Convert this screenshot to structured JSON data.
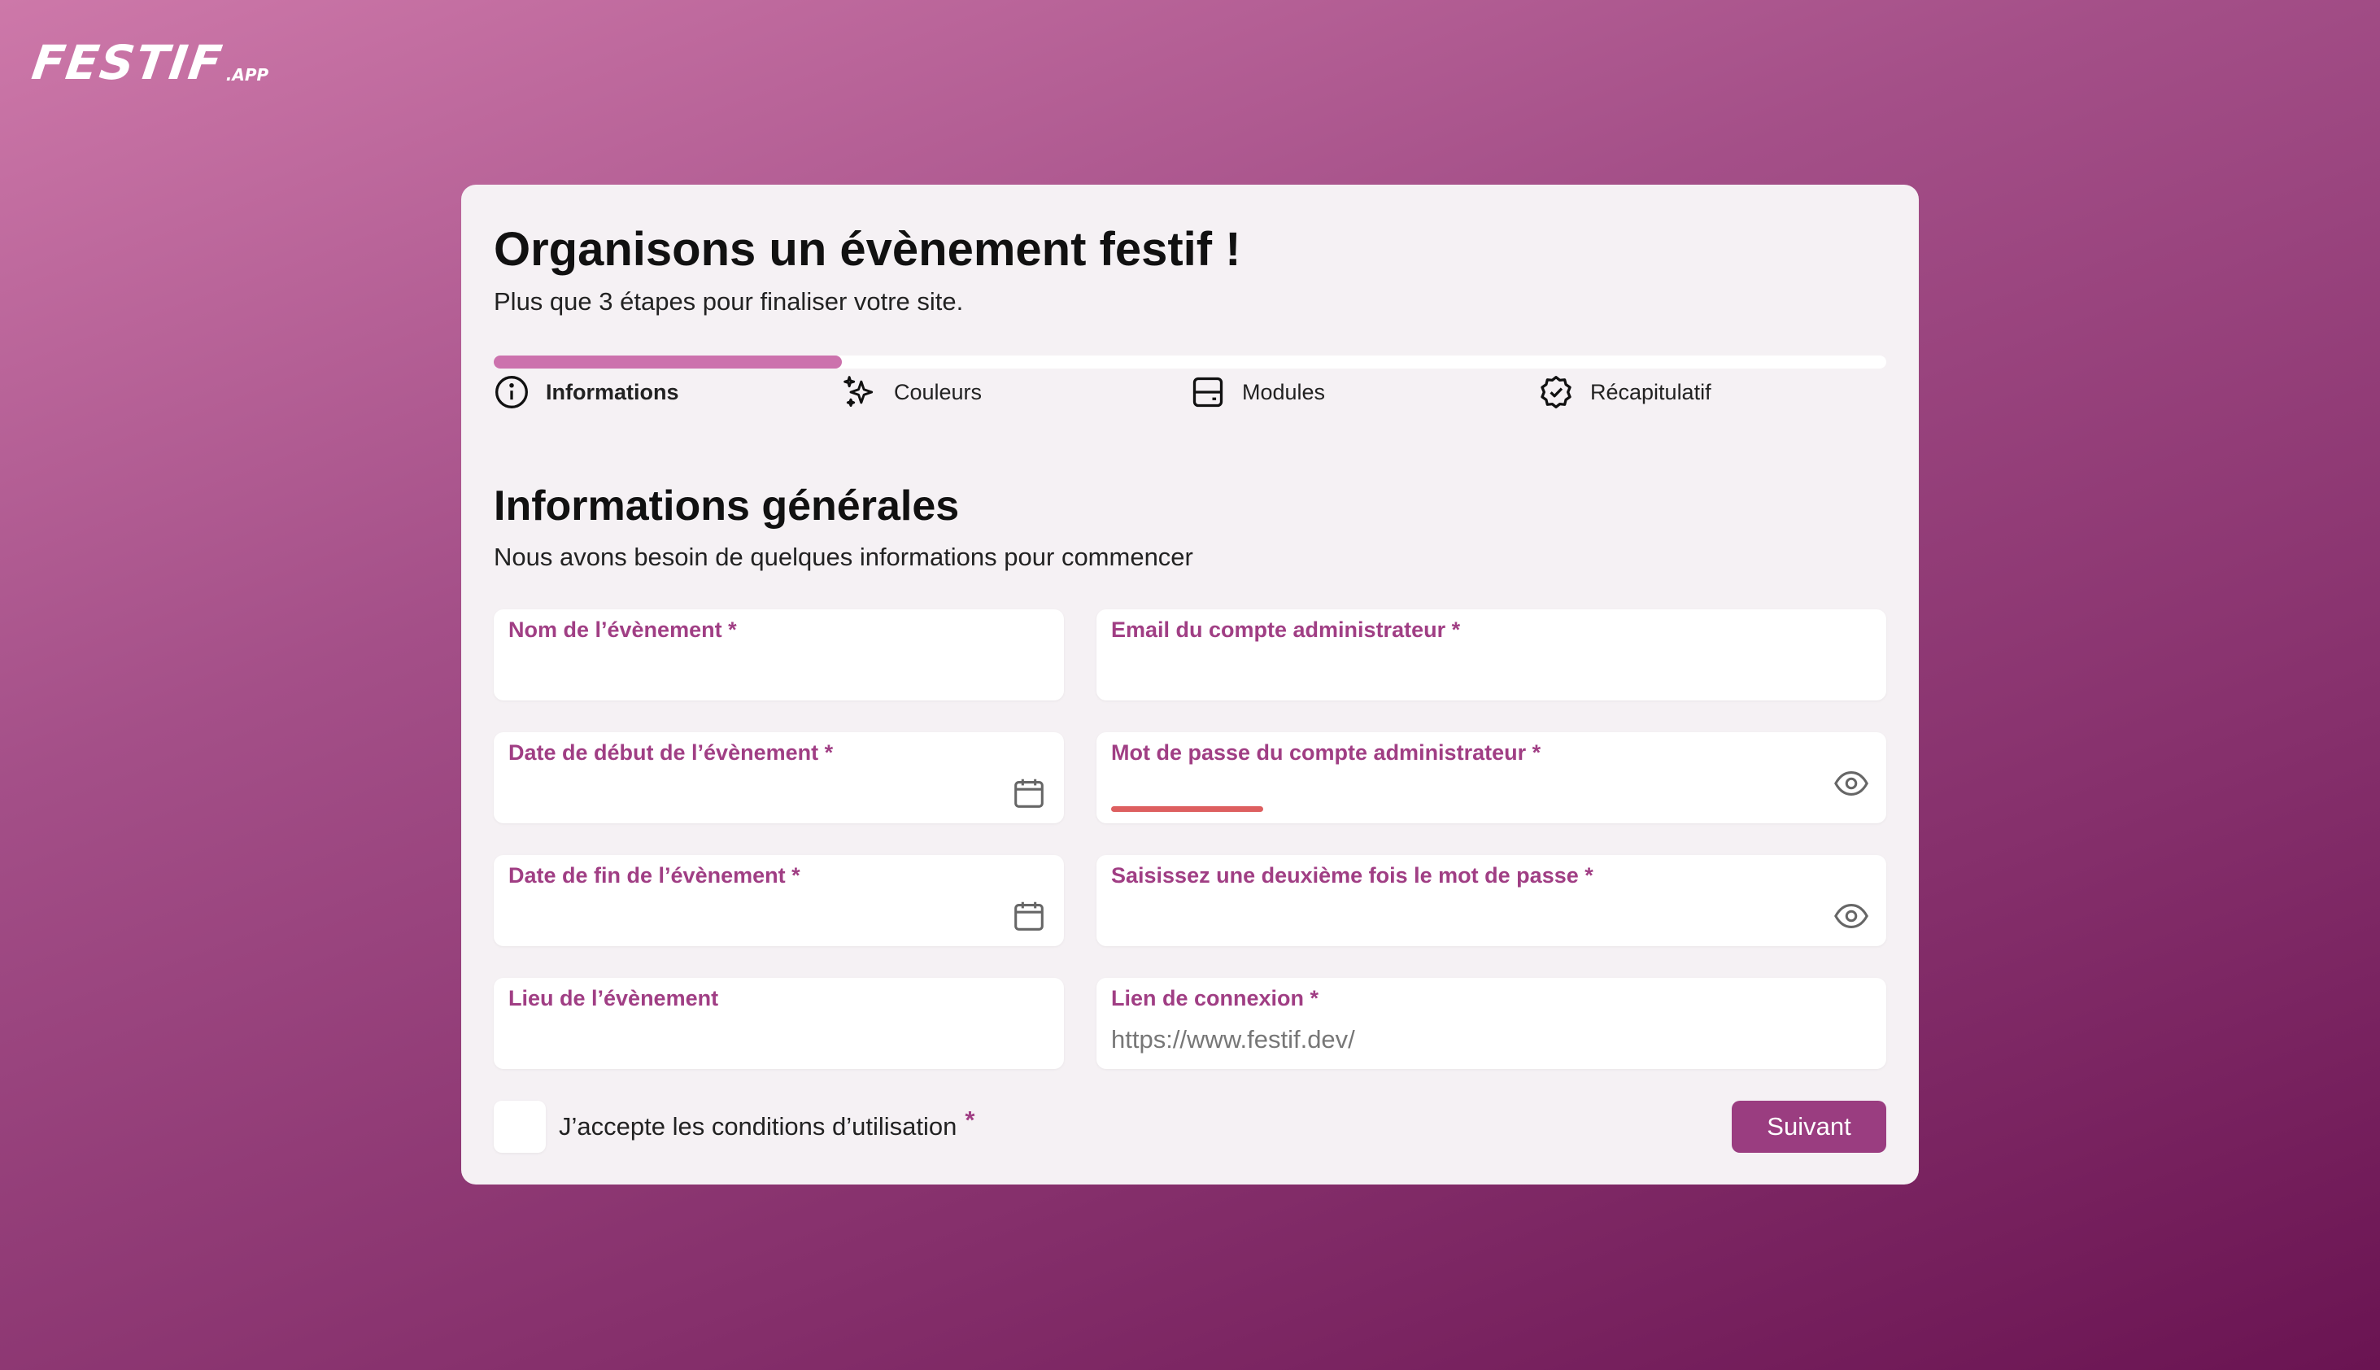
{
  "brand": {
    "name": "FESTIF",
    "suffix": ".APP"
  },
  "header": {
    "title": "Organisons un évènement festif !",
    "subtitle": "Plus que 3 étapes pour finaliser votre site."
  },
  "progress": {
    "value": 0.25
  },
  "steps": [
    {
      "label": "Informations",
      "icon": "info-icon",
      "active": true
    },
    {
      "label": "Couleurs",
      "icon": "sparkles-icon",
      "active": false
    },
    {
      "label": "Modules",
      "icon": "server-icon",
      "active": false
    },
    {
      "label": "Récapitulatif",
      "icon": "check-badge-icon",
      "active": false
    }
  ],
  "section": {
    "title": "Informations générales",
    "subtitle": "Nous avons besoin de quelques informations pour commencer"
  },
  "fields": {
    "event_name": {
      "label": "Nom de l’évènement *",
      "value": "",
      "placeholder": ""
    },
    "admin_email": {
      "label": "Email du compte administrateur *",
      "value": "",
      "placeholder": ""
    },
    "start_date": {
      "label": "Date de début de l’évènement *",
      "value": "",
      "placeholder": "",
      "icon": "calendar-icon"
    },
    "admin_password": {
      "label": "Mot de passe du compte administrateur *",
      "value": "",
      "placeholder": "",
      "icon": "eye-icon",
      "strength_color": "#dd5f60"
    },
    "end_date": {
      "label": "Date de fin de l’évènement *",
      "value": "",
      "placeholder": "",
      "icon": "calendar-icon"
    },
    "password_confirm": {
      "label": "Saisissez une deuxième fois le mot de passe *",
      "value": "",
      "placeholder": "",
      "icon": "eye-icon"
    },
    "location": {
      "label": "Lieu de l’évènement",
      "value": "",
      "placeholder": ""
    },
    "connection_link": {
      "label": "Lien de connexion *",
      "value": "",
      "placeholder": "https://www.festif.dev/"
    }
  },
  "terms": {
    "label": "J’accepte les conditions d’utilisation",
    "required_mark": "*",
    "checked": false
  },
  "actions": {
    "next_label": "Suivant"
  },
  "colors": {
    "accent": "#9a3d80",
    "label": "#a03e84",
    "progress": "#cc72ad"
  }
}
